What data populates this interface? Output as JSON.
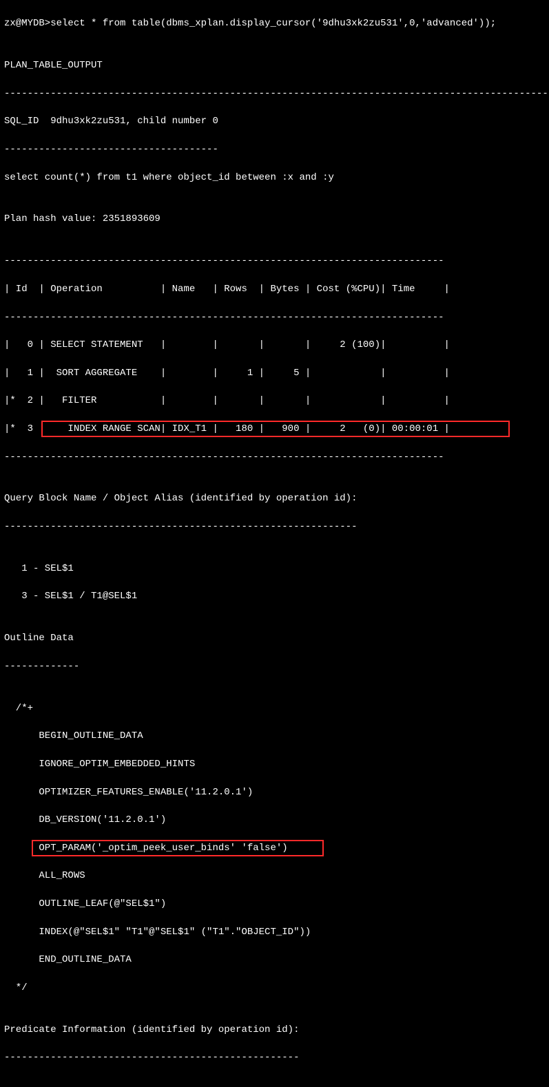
{
  "prompt": "zx@MYDB>",
  "command": "select * from table(dbms_xplan.display_cursor('9dhu3xk2zu531',0,'advanced'));",
  "header_blank": "",
  "plan_table_output_label": "PLAN_TABLE_OUTPUT",
  "dash_line": "----------------------------------------------------------------------------------------------------",
  "sql_id_line": "SQL_ID  9dhu3xk2zu531, child number 0",
  "sql_id_dash": "-------------------------------------",
  "sql_text": "select count(*) from t1 where object_id between :x and :y",
  "plan_hash": "Plan hash value: 2351893609",
  "table": {
    "border": "----------------------------------------------------------------------------",
    "header": "| Id  | Operation          | Name   | Rows  | Bytes | Cost (%CPU)| Time     |",
    "r0": "|   0 | SELECT STATEMENT   |        |       |       |     2 (100)|          |",
    "r1": "|   1 |  SORT AGGREGATE    |        |     1 |     5 |            |          |",
    "r2": "|*  2 |   FILTER           |        |       |       |            |          |",
    "r3": "|*  3 |    INDEX RANGE SCAN| IDX_T1 |   180 |   900 |     2   (0)| 00:00:01 |"
  },
  "qb": {
    "title": "Query Block Name / Object Alias (identified by operation id):",
    "dash": "-------------------------------------------------------------",
    "l1": "   1 - SEL$1",
    "l2": "   3 - SEL$1 / T1@SEL$1"
  },
  "outline": {
    "title": "Outline Data",
    "dash": "-------------",
    "open": "  /*+",
    "l1": "      BEGIN_OUTLINE_DATA",
    "l2": "      IGNORE_OPTIM_EMBEDDED_HINTS",
    "l3": "      OPTIMIZER_FEATURES_ENABLE('11.2.0.1')",
    "l4": "      DB_VERSION('11.2.0.1')",
    "l5": "      OPT_PARAM('_optim_peek_user_binds' 'false')",
    "l6": "      ALL_ROWS",
    "l7": "      OUTLINE_LEAF(@\"SEL$1\")",
    "l8": "      INDEX(@\"SEL$1\" \"T1\"@\"SEL$1\" (\"T1\".\"OBJECT_ID\"))",
    "l9": "      END_OUTLINE_DATA",
    "close": "  */"
  },
  "pred": {
    "title": "Predicate Information (identified by operation id):",
    "dash": "---------------------------------------------------"
  }
}
